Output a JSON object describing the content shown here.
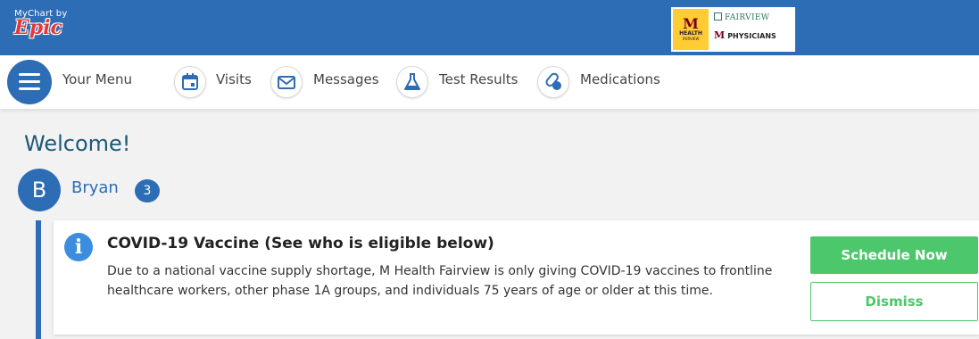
{
  "header": {
    "brand_small": "MyChart by",
    "brand_epic": "Epic",
    "logo": {
      "m_mark": "M",
      "health": "HEALTH",
      "fairview_small": "FAIRVIEW",
      "fairview": "FAIRVIEW",
      "physicians_mark": "M",
      "physicians": "PHYSICIANS"
    }
  },
  "nav": {
    "menu_label": "Your Menu",
    "items": [
      {
        "label": "Visits",
        "icon": "calendar-icon"
      },
      {
        "label": "Messages",
        "icon": "envelope-icon"
      },
      {
        "label": "Test Results",
        "icon": "flask-icon"
      },
      {
        "label": "Medications",
        "icon": "pills-icon"
      }
    ]
  },
  "main": {
    "welcome": "Welcome!",
    "user": {
      "initial": "B",
      "name": "Bryan",
      "badge_count": "3"
    },
    "alert": {
      "icon": "info-icon",
      "title": "COVID-19 Vaccine (See who is eligible below)",
      "body": "Due to a national vaccine supply shortage, M Health Fairview is only giving COVID-19 vaccines to frontline healthcare workers, other phase 1A groups, and individuals 75 years of age or older at this time.",
      "primary_button": "Schedule Now",
      "secondary_button": "Dismiss"
    }
  },
  "colors": {
    "brand_blue": "#2d6db5",
    "accent_green": "#4cc76b",
    "info_blue": "#3b8de0",
    "welcome_text": "#1d5a77"
  }
}
